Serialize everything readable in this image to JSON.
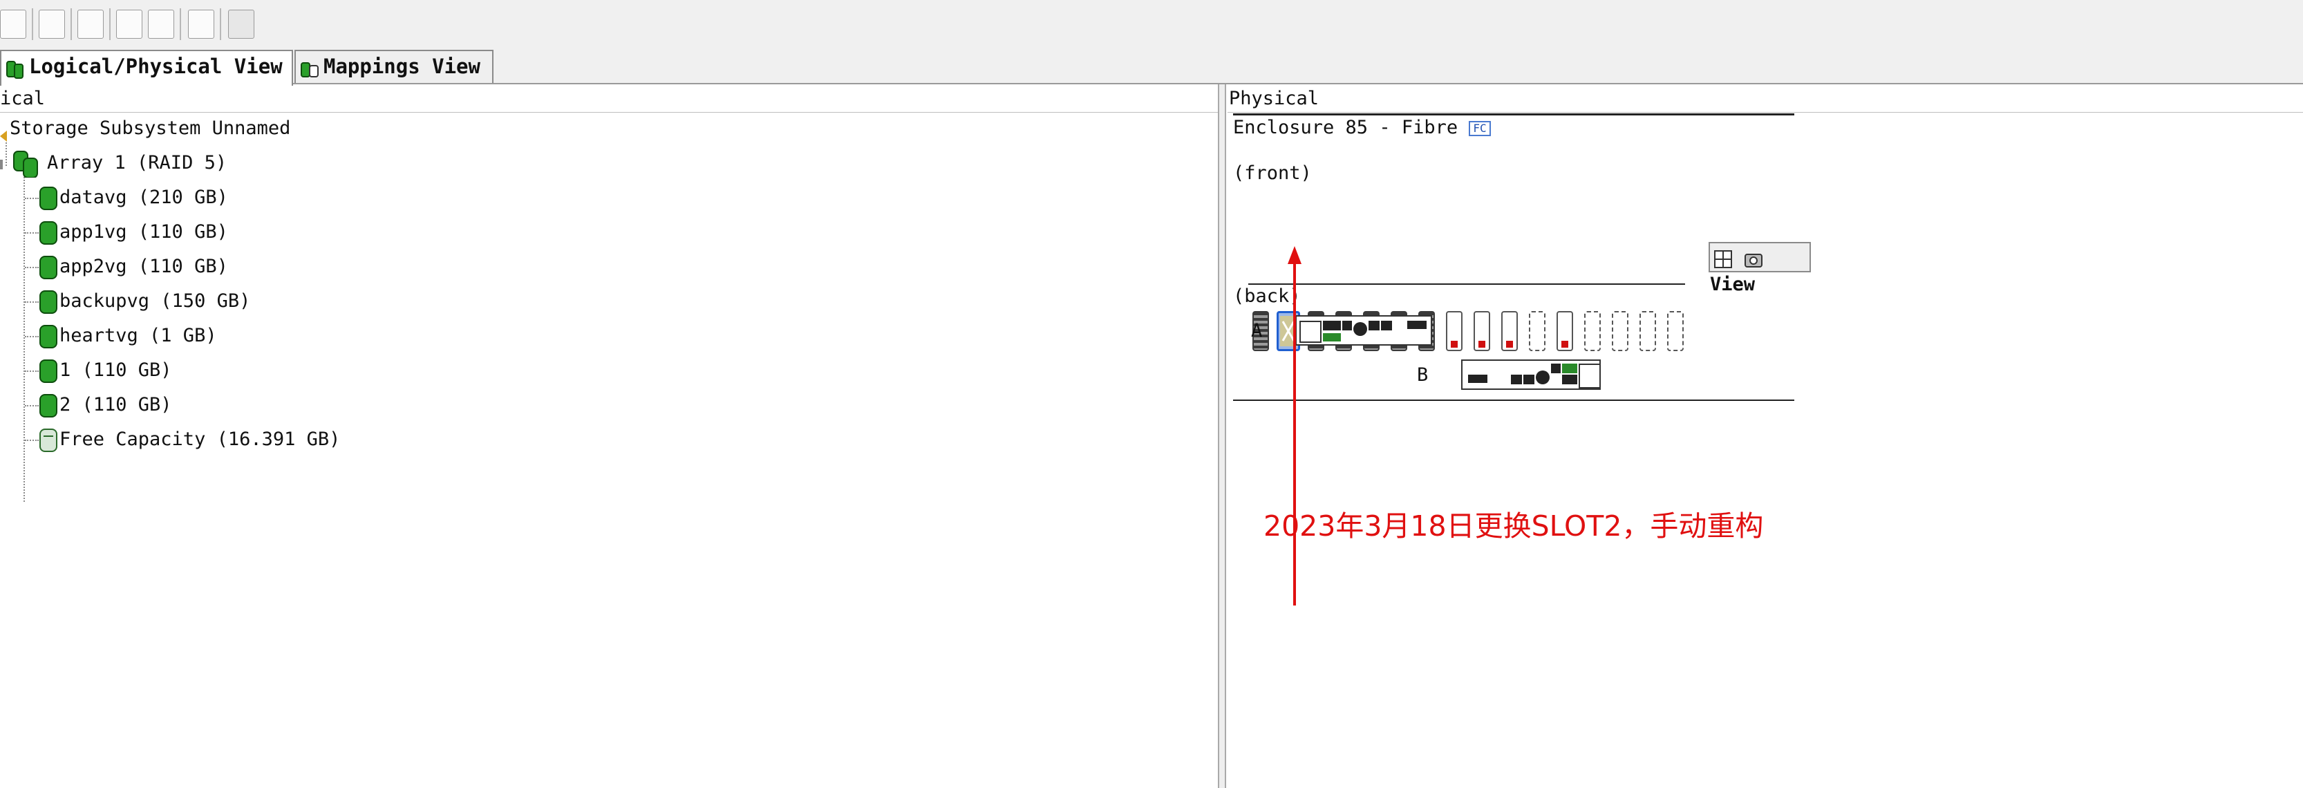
{
  "toolbar": {
    "icons": [
      "book-icon",
      "stopwatch-icon",
      "list-icon",
      "phone-icon",
      "bell-icon",
      "document-stack-icon",
      "heart-icon"
    ]
  },
  "tabs": [
    {
      "label": "Logical/Physical View",
      "active": true
    },
    {
      "label": "Mappings View",
      "active": false
    }
  ],
  "logical": {
    "header": "ical",
    "subsystem": "Storage Subsystem Unnamed",
    "array": "Array 1 (RAID 5)",
    "volumes": [
      "datavg (210 GB)",
      "app1vg (110 GB)",
      "app2vg (110 GB)",
      "backupvg (150 GB)",
      "heartvg (1 GB)",
      "1 (110 GB)",
      "2 (110 GB)"
    ],
    "free": "Free Capacity (16.391 GB)"
  },
  "physical": {
    "header": "Physical",
    "enclosure": "Enclosure 85 - Fibre",
    "fc_badge": "FC",
    "front_label": "(front)",
    "back_label": "(back)",
    "controller_a": "A",
    "controller_b": "B",
    "view_button": "View",
    "slots": [
      "filled",
      "selected",
      "filled",
      "filled",
      "filled",
      "filled",
      "filled",
      "red",
      "red",
      "red",
      "empty",
      "red",
      "empty",
      "empty",
      "empty",
      "empty"
    ],
    "accent_color": "#1f5fd0"
  },
  "annotation": {
    "text": "2023年3月18日更换SLOT2，手动重构",
    "color": "#e01010"
  }
}
